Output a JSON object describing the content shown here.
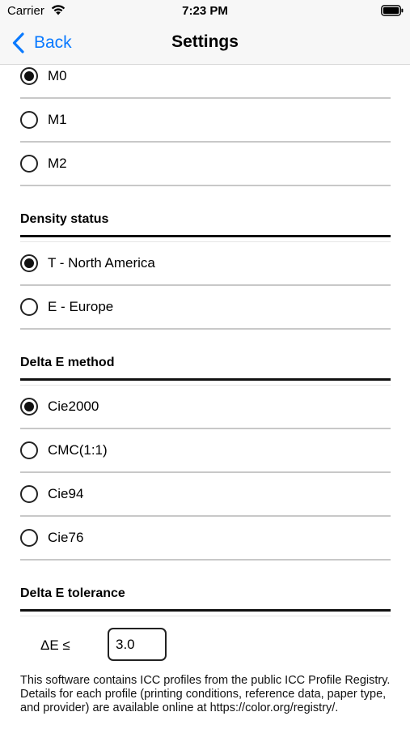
{
  "status_bar": {
    "carrier": "Carrier",
    "time": "7:23 PM"
  },
  "nav": {
    "back_label": "Back",
    "title": "Settings"
  },
  "measurement_modes": [
    {
      "label": "M0",
      "checked": true
    },
    {
      "label": "M1",
      "checked": false
    },
    {
      "label": "M2",
      "checked": false
    }
  ],
  "density_status": {
    "title": "Density status",
    "options": [
      {
        "label": "T - North America",
        "checked": true
      },
      {
        "label": "E - Europe",
        "checked": false
      }
    ]
  },
  "delta_e_method": {
    "title": "Delta E method",
    "options": [
      {
        "label": "Cie2000",
        "checked": true
      },
      {
        "label": "CMC(1:1)",
        "checked": false
      },
      {
        "label": "Cie94",
        "checked": false
      },
      {
        "label": "Cie76",
        "checked": false
      }
    ]
  },
  "delta_e_tolerance": {
    "title": "Delta E tolerance",
    "label": "ΔE ≤",
    "value": "3.0"
  },
  "footer_text": "This software contains ICC profiles from the public ICC Profile Registry. Details for each profile (printing conditions, reference data, paper type, and provider) are available online at https://color.org/registry/.",
  "colors": {
    "accent": "#0a7aff"
  }
}
